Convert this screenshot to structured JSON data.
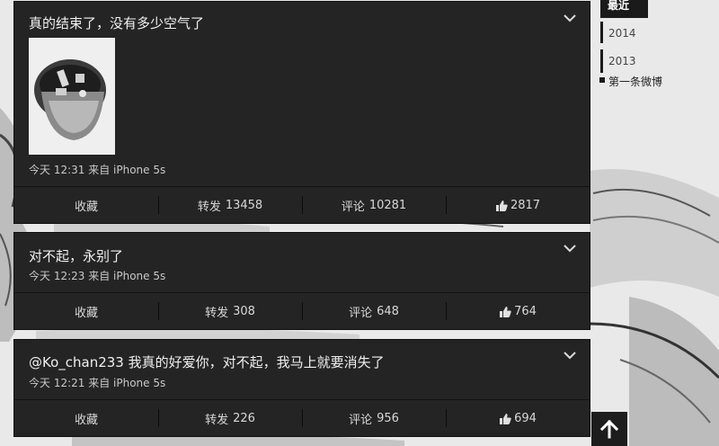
{
  "sidebar": {
    "items": [
      {
        "label": "最近"
      },
      {
        "label": "2014"
      },
      {
        "label": "2013"
      },
      {
        "label": "第一条微博"
      }
    ]
  },
  "posts": [
    {
      "text": "真的结束了，没有多少空气了",
      "meta": "今天 12:31 来自 iPhone 5s",
      "has_image": true,
      "actions": {
        "collect": "收藏",
        "repost_label": "转发",
        "repost_count": "13458",
        "comment_label": "评论",
        "comment_count": "10281",
        "likes": "2817"
      }
    },
    {
      "text": "对不起，永别了",
      "meta": "今天 12:23 来自 iPhone 5s",
      "has_image": false,
      "actions": {
        "collect": "收藏",
        "repost_label": "转发",
        "repost_count": "308",
        "comment_label": "评论",
        "comment_count": "648",
        "likes": "764"
      }
    },
    {
      "text": "@Ko_chan233 我真的好爱你，对不起，我马上就要消失了",
      "meta": "今天 12:21 来自 iPhone 5s",
      "has_image": false,
      "actions": {
        "collect": "收藏",
        "repost_label": "转发",
        "repost_count": "226",
        "comment_label": "评论",
        "comment_count": "956",
        "likes": "694"
      }
    }
  ],
  "colors": {
    "card_bg": "#242424",
    "page_bg": "#ececec",
    "sidebar_active": "#1a1a1a"
  },
  "icons": {
    "expand": "chevron-down-icon",
    "like": "thumbs-up-icon",
    "back_to_top": "arrow-up-icon"
  }
}
